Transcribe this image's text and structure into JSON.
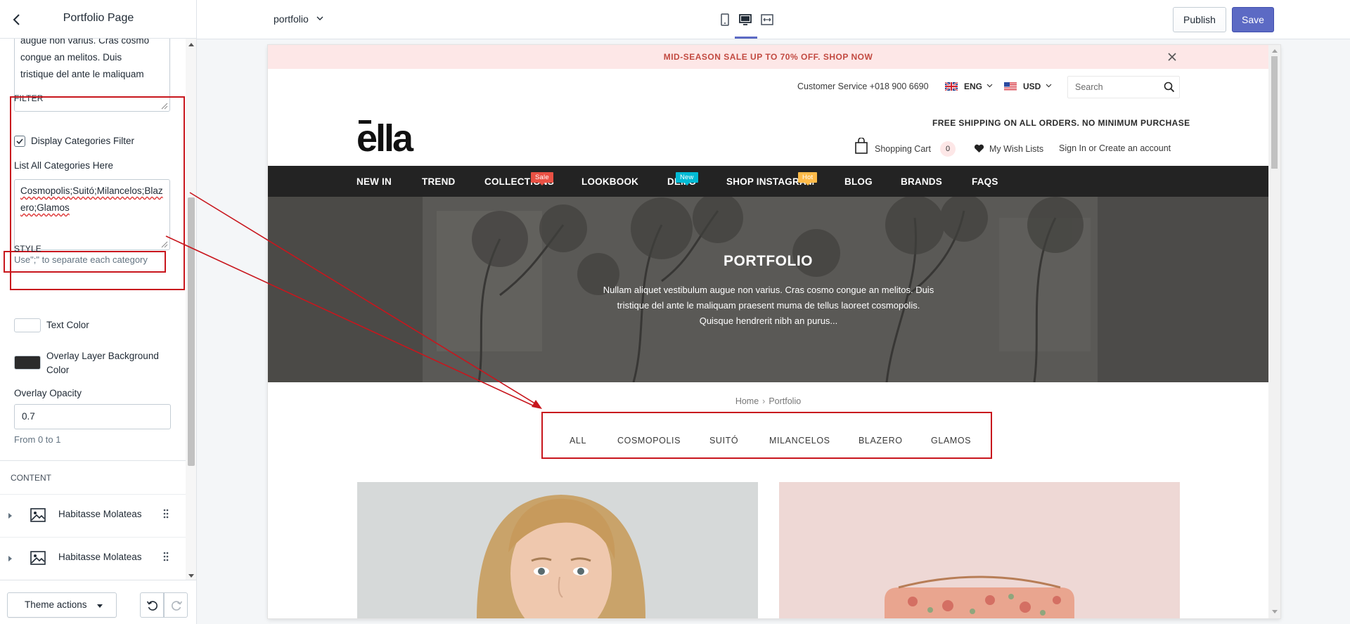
{
  "sidebar": {
    "title": "Portfolio Page",
    "description_text": "augue non varius. Cras cosmo\ncongue an melitos. Duis\ntristique del ante le maliquam",
    "filter": {
      "section_label": "FILTER",
      "display_filter_label": "Display Categories Filter",
      "display_filter_checked": true,
      "list_label": "List All Categories Here",
      "categories_value": "Cosmopolis;Suitó;Milancelos;Blazero;Glamos",
      "hint": "Use\";\" to separate each category"
    },
    "style": {
      "section_label": "STYLE",
      "text_color_label": "Text Color",
      "text_color": "#ffffff",
      "overlay_color_label": "Overlay Layer Background Color",
      "overlay_color": "#2b2b2b",
      "opacity_label": "Overlay Opacity",
      "opacity_value": "0.7",
      "opacity_help": "From 0 to 1"
    },
    "content": {
      "section_label": "CONTENT",
      "blocks": [
        {
          "label": "Habitasse Molateas"
        },
        {
          "label": "Habitasse Molateas"
        }
      ]
    },
    "footer": {
      "theme_actions_label": "Theme actions"
    }
  },
  "topbar": {
    "page_selector": "portfolio",
    "publish_label": "Publish",
    "save_label": "Save",
    "active_device": "desktop"
  },
  "preview": {
    "announcement": "MID-SEASON SALE UP TO 70% OFF. SHOP NOW",
    "customer_service": "Customer Service +018 900 6690",
    "language": "ENG",
    "currency": "USD",
    "search_placeholder": "Search",
    "logo_text": "ella",
    "free_shipping": "FREE SHIPPING ON ALL ORDERS. NO MINIMUM PURCHASE",
    "cart_label": "Shopping Cart",
    "cart_count": "0",
    "wishlist_label": "My Wish Lists",
    "account_label": "Sign In or Create an account",
    "nav": [
      {
        "label": "NEW IN"
      },
      {
        "label": "TREND"
      },
      {
        "label": "COLLECTIONS",
        "badge": "Sale",
        "badge_color": "#e95144"
      },
      {
        "label": "LOOKBOOK"
      },
      {
        "label": "DEMO",
        "badge": "New",
        "badge_color": "#01bad4"
      },
      {
        "label": "SHOP INSTAGRAM",
        "badge": "Hot",
        "badge_color": "#ffbb49"
      },
      {
        "label": "BLOG"
      },
      {
        "label": "BRANDS"
      },
      {
        "label": "FAQS"
      }
    ],
    "hero_title": "PORTFOLIO",
    "hero_description": "Nullam aliquet vestibulum augue non varius. Cras cosmo congue an melitos. Duis tristique del ante le maliquam praesent muma de tellus laoreet cosmopolis. Quisque hendrerit nibh an purus...",
    "breadcrumb": {
      "home": "Home",
      "current": "Portfolio"
    },
    "category_tabs": [
      "ALL",
      "COSMOPOLIS",
      "SUITÓ",
      "MILANCELOS",
      "BLAZERO",
      "GLAMOS"
    ]
  },
  "colors": {
    "accent": "#5c6ac4",
    "annotation_red": "#c8161d",
    "announcement_bg": "#fde7e7",
    "nav_bg": "#232323"
  }
}
